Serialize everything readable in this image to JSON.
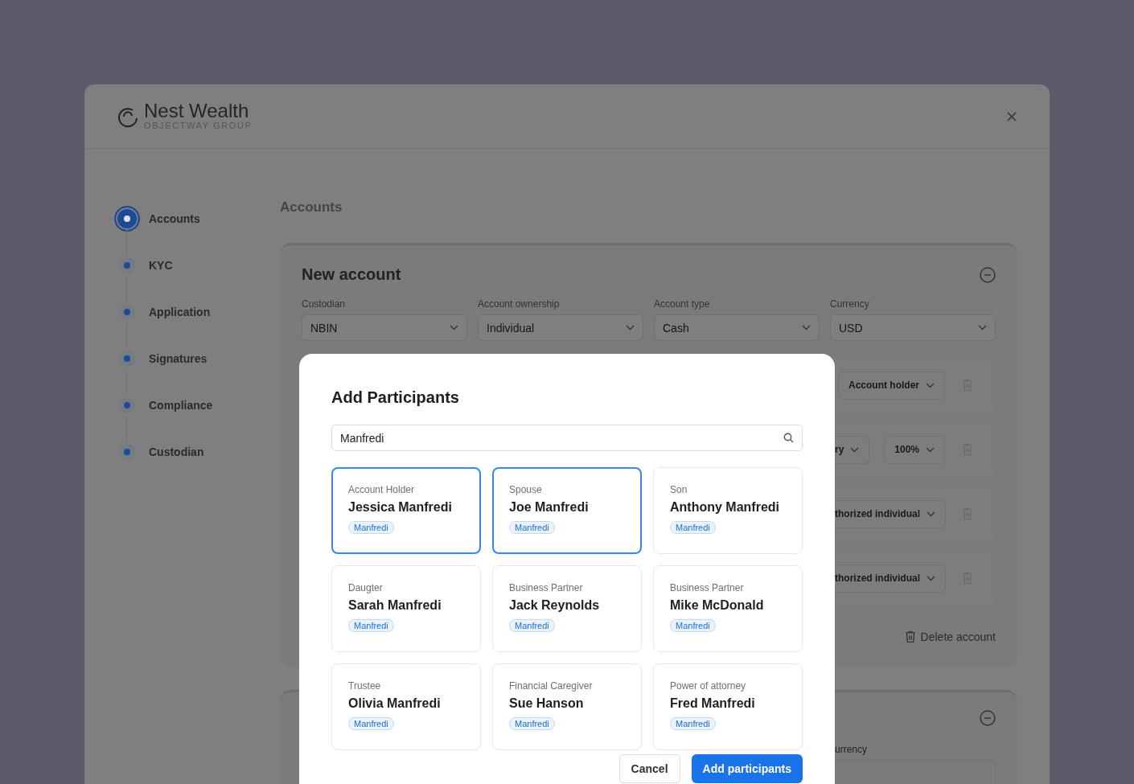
{
  "brand": {
    "name": "Nest Wealth",
    "tagline": "OBJECTWAY GROUP"
  },
  "steps": [
    {
      "label": "Accounts",
      "selected": true
    },
    {
      "label": "KYC",
      "selected": false
    },
    {
      "label": "Application",
      "selected": false
    },
    {
      "label": "Signatures",
      "selected": false
    },
    {
      "label": "Compliance",
      "selected": false
    },
    {
      "label": "Custodian",
      "selected": false
    }
  ],
  "page_title": "Accounts",
  "account_panel": {
    "title": "New account",
    "fields": [
      {
        "label": "Custodian",
        "value": "NBIN"
      },
      {
        "label": "Account ownership",
        "value": "Individual"
      },
      {
        "label": "Account type",
        "value": "Cash"
      },
      {
        "label": "Currency",
        "value": "USD"
      }
    ],
    "participant_rows": [
      {
        "selects": [
          {
            "value": "Account holder",
            "kind": "full"
          }
        ]
      },
      {
        "selects": [
          {
            "value": "ry",
            "kind": "cut"
          },
          {
            "value": "100%",
            "kind": "full"
          }
        ]
      },
      {
        "selects": [
          {
            "value": "thorized individual",
            "kind": "cut"
          }
        ]
      },
      {
        "selects": [
          {
            "value": "thorized individual",
            "kind": "cut"
          }
        ]
      }
    ],
    "delete_label": "Delete account"
  },
  "second_panel": {
    "field_label": "urrency"
  },
  "modal": {
    "title": "Add Participants",
    "search": {
      "value": "Manfredi"
    },
    "participants": [
      {
        "role": "Account Holder",
        "name": "Jessica Manfredi",
        "tag": "Manfredi",
        "selected": true
      },
      {
        "role": "Spouse",
        "name": "Joe Manfredi",
        "tag": "Manfredi",
        "selected": true
      },
      {
        "role": "Son",
        "name": "Anthony Manfredi",
        "tag": "Manfredi",
        "selected": false
      },
      {
        "role": "Daugter",
        "name": "Sarah Manfredi",
        "tag": "Manfredi",
        "selected": false
      },
      {
        "role": "Business Partner",
        "name": "Jack Reynolds",
        "tag": "Manfredi",
        "selected": false
      },
      {
        "role": "Business Partner",
        "name": "Mike McDonald",
        "tag": "Manfredi",
        "selected": false
      },
      {
        "role": "Trustee",
        "name": "Olivia Manfredi",
        "tag": "Manfredi",
        "selected": false
      },
      {
        "role": "Financial Caregiver",
        "name": "Sue Hanson",
        "tag": "Manfredi",
        "selected": false
      },
      {
        "role": "Power of attorney",
        "name": "Fred Manfredi",
        "tag": "Manfredi",
        "selected": false
      }
    ],
    "buttons": [
      {
        "label": "Cancel",
        "kind": "secondary"
      },
      {
        "label": "Add participants",
        "kind": "primary"
      }
    ]
  }
}
